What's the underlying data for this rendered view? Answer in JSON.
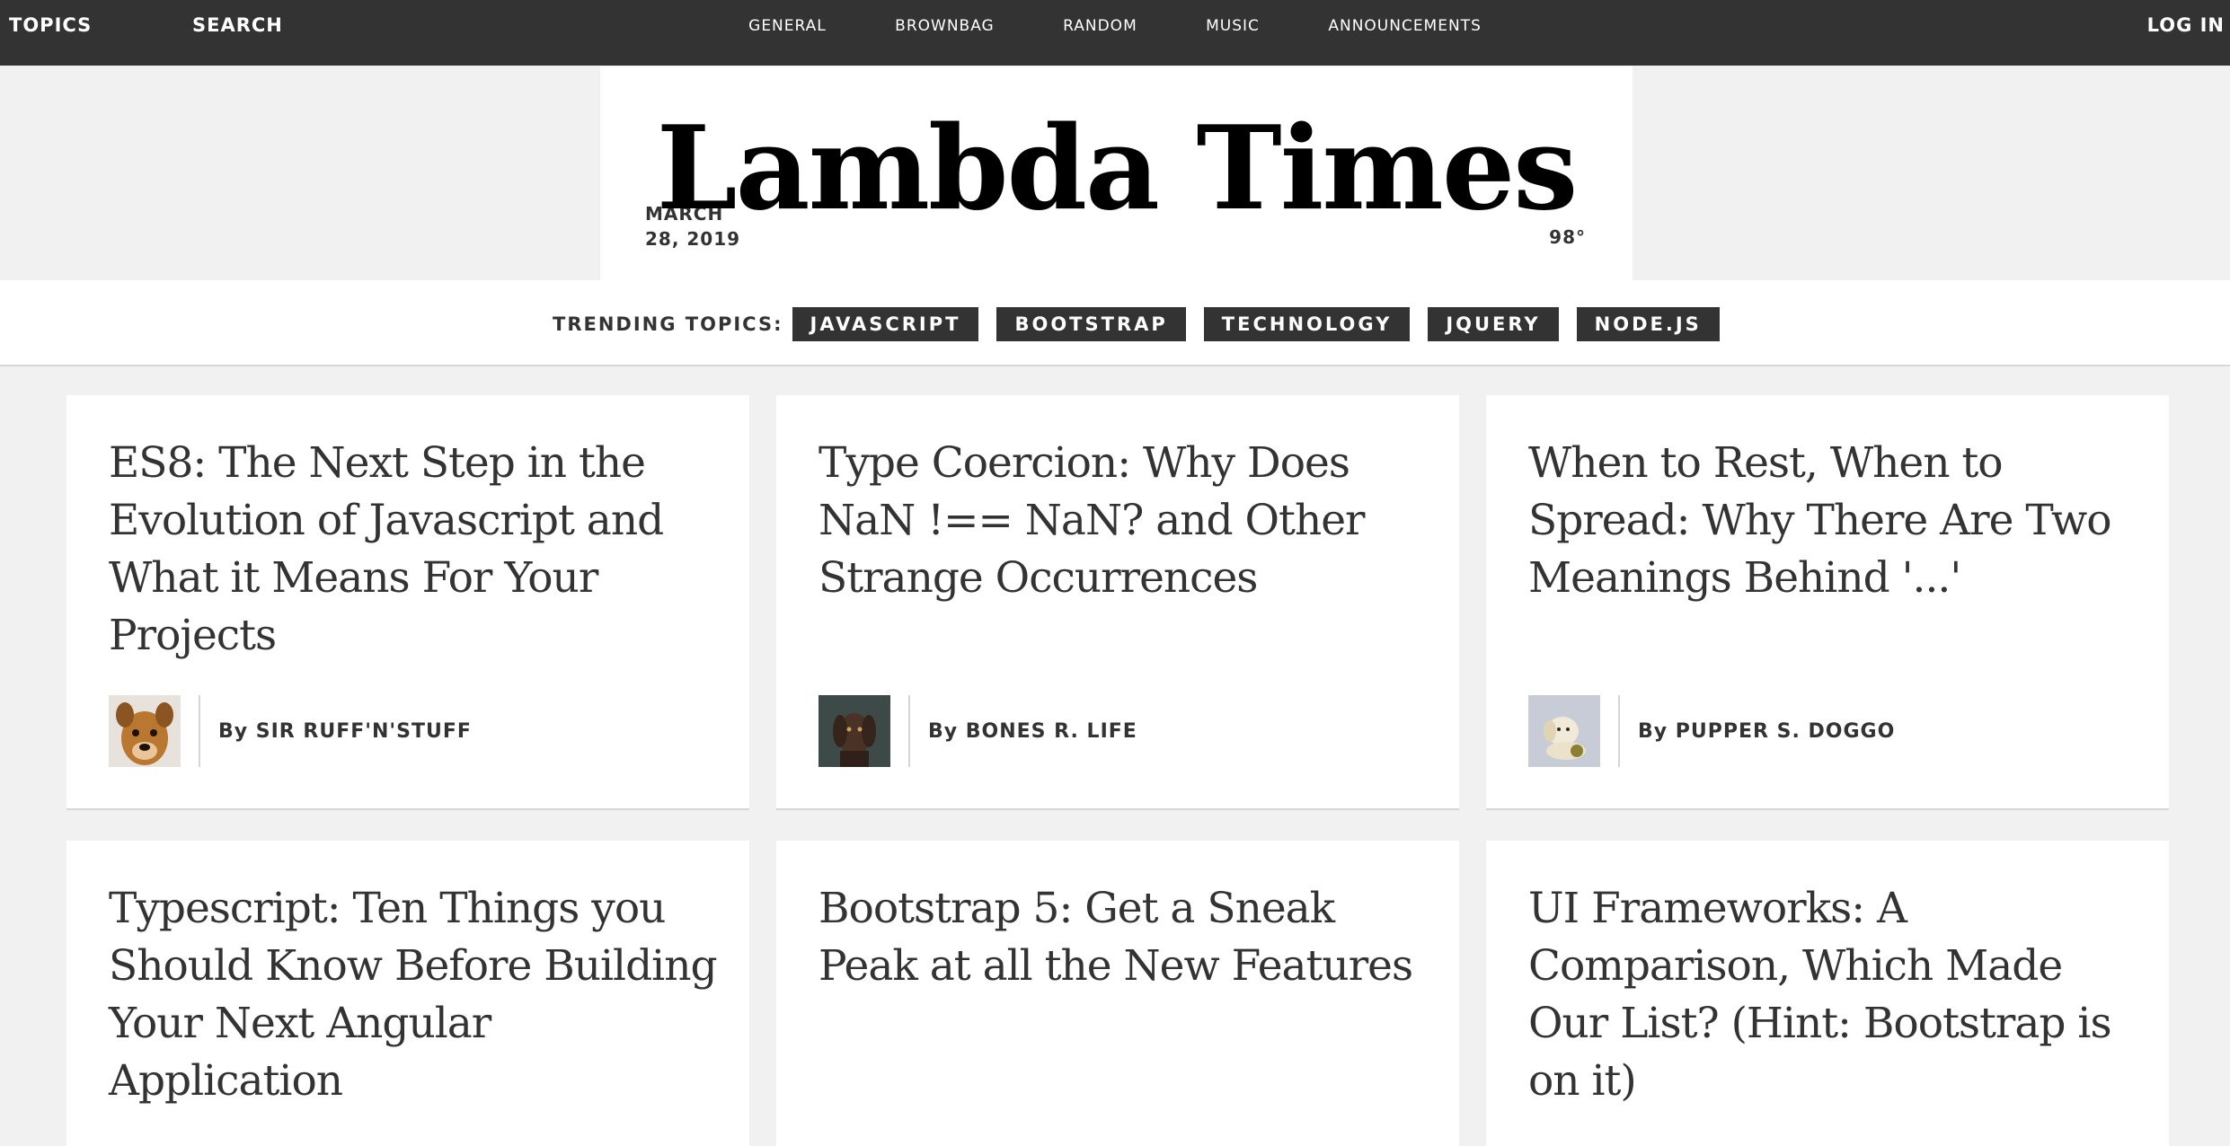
{
  "topbar": {
    "topics_label": "TOPICS",
    "search_label": "SEARCH",
    "nav": [
      "GENERAL",
      "BROWNBAG",
      "RANDOM",
      "MUSIC",
      "ANNOUNCEMENTS"
    ],
    "login_label": "LOG IN"
  },
  "header": {
    "title": "Lambda Times",
    "date_line1": "MARCH",
    "date_line2": "28, 2019",
    "temperature": "98°"
  },
  "trending": {
    "label": "TRENDING TOPICS:",
    "tags": [
      "JAVASCRIPT",
      "BOOTSTRAP",
      "TECHNOLOGY",
      "JQUERY",
      "NODE.JS"
    ]
  },
  "articles": [
    {
      "headline": "ES8: The Next Step in the Evolution of Javascript and What it Means For Your Projects",
      "author": "By SIR RUFF'N'STUFF",
      "avatar": "dog-photo-tan"
    },
    {
      "headline": "Type Coercion: Why Does NaN !== NaN? and Other Strange Occurrences",
      "author": "By BONES R. LIFE",
      "avatar": "dog-photo-dark"
    },
    {
      "headline": "When to Rest, When to Spread: Why There Are Two Meanings Behind '...'",
      "author": "By PUPPER S. DOGGO",
      "avatar": "puppy-photo-white"
    },
    {
      "headline": "Typescript: Ten Things you Should Know Before Building Your Next Angular Application",
      "author": "",
      "avatar": ""
    },
    {
      "headline": "Bootstrap 5: Get a Sneak Peak at all the New Features",
      "author": "",
      "avatar": ""
    },
    {
      "headline": "UI Frameworks: A Comparison, Which Made Our List? (Hint: Bootstrap is on it)",
      "author": "",
      "avatar": ""
    }
  ],
  "colors": {
    "topbar_bg": "#333333",
    "page_bg": "#f1f1f1",
    "card_bg": "#ffffff",
    "tag_bg": "#333333"
  }
}
